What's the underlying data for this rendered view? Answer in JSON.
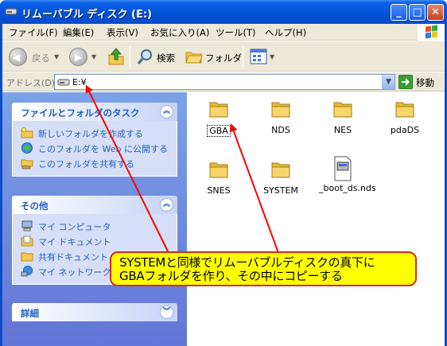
{
  "window": {
    "title": "リムーバブル ディスク (E:)",
    "controls": {
      "minimize": "_",
      "maximize": "□",
      "close": "✕"
    }
  },
  "menubar": {
    "items": [
      "ファイル(F)",
      "編集(E)",
      "表示(V)",
      "お気に入り(A)",
      "ツール(T)",
      "ヘルプ(H)"
    ]
  },
  "toolbar": {
    "back_label": "戻る",
    "search_label": "検索",
    "folders_label": "フォルダ"
  },
  "address": {
    "label": "アドレス(D)",
    "value": "E:¥",
    "go_label": "移動"
  },
  "taskpane": {
    "groups": [
      {
        "title": "ファイルとフォルダのタスク",
        "items": [
          {
            "label": "新しいフォルダを作成する",
            "icon": "new-folder-icon"
          },
          {
            "label": "このフォルダを Web に公開する",
            "icon": "publish-web-icon"
          },
          {
            "label": "このフォルダを共有する",
            "icon": "share-folder-icon"
          }
        ]
      },
      {
        "title": "その他",
        "items": [
          {
            "label": "マイ コンピュータ",
            "icon": "my-computer-icon"
          },
          {
            "label": "マイ ドキュメント",
            "icon": "my-documents-icon"
          },
          {
            "label": "共有ドキュメント",
            "icon": "shared-documents-icon"
          },
          {
            "label": "マイ ネットワーク",
            "icon": "my-network-icon"
          }
        ]
      },
      {
        "title": "詳細",
        "items": []
      }
    ]
  },
  "files": [
    {
      "name": "GBA",
      "type": "folder",
      "focused": true
    },
    {
      "name": "NDS",
      "type": "folder"
    },
    {
      "name": "NES",
      "type": "folder"
    },
    {
      "name": "pdaDS",
      "type": "folder"
    },
    {
      "name": "SNES",
      "type": "folder"
    },
    {
      "name": "SYSTEM",
      "type": "folder"
    },
    {
      "name": "_boot_ds.nds",
      "type": "file"
    }
  ],
  "annotation": {
    "line1": "SYSTEMと同様でリムーバブルディスクの真下に",
    "line2": "GBAフォルダを作り、その中にコピーする",
    "colors": {
      "fill": "#ffff00",
      "border": "#d32a1a",
      "arrow": "#ff0000"
    }
  },
  "colors": {
    "titlebar": "#0553d8",
    "chrome": "#ece9d8",
    "taskpane_link": "#215dc6"
  }
}
